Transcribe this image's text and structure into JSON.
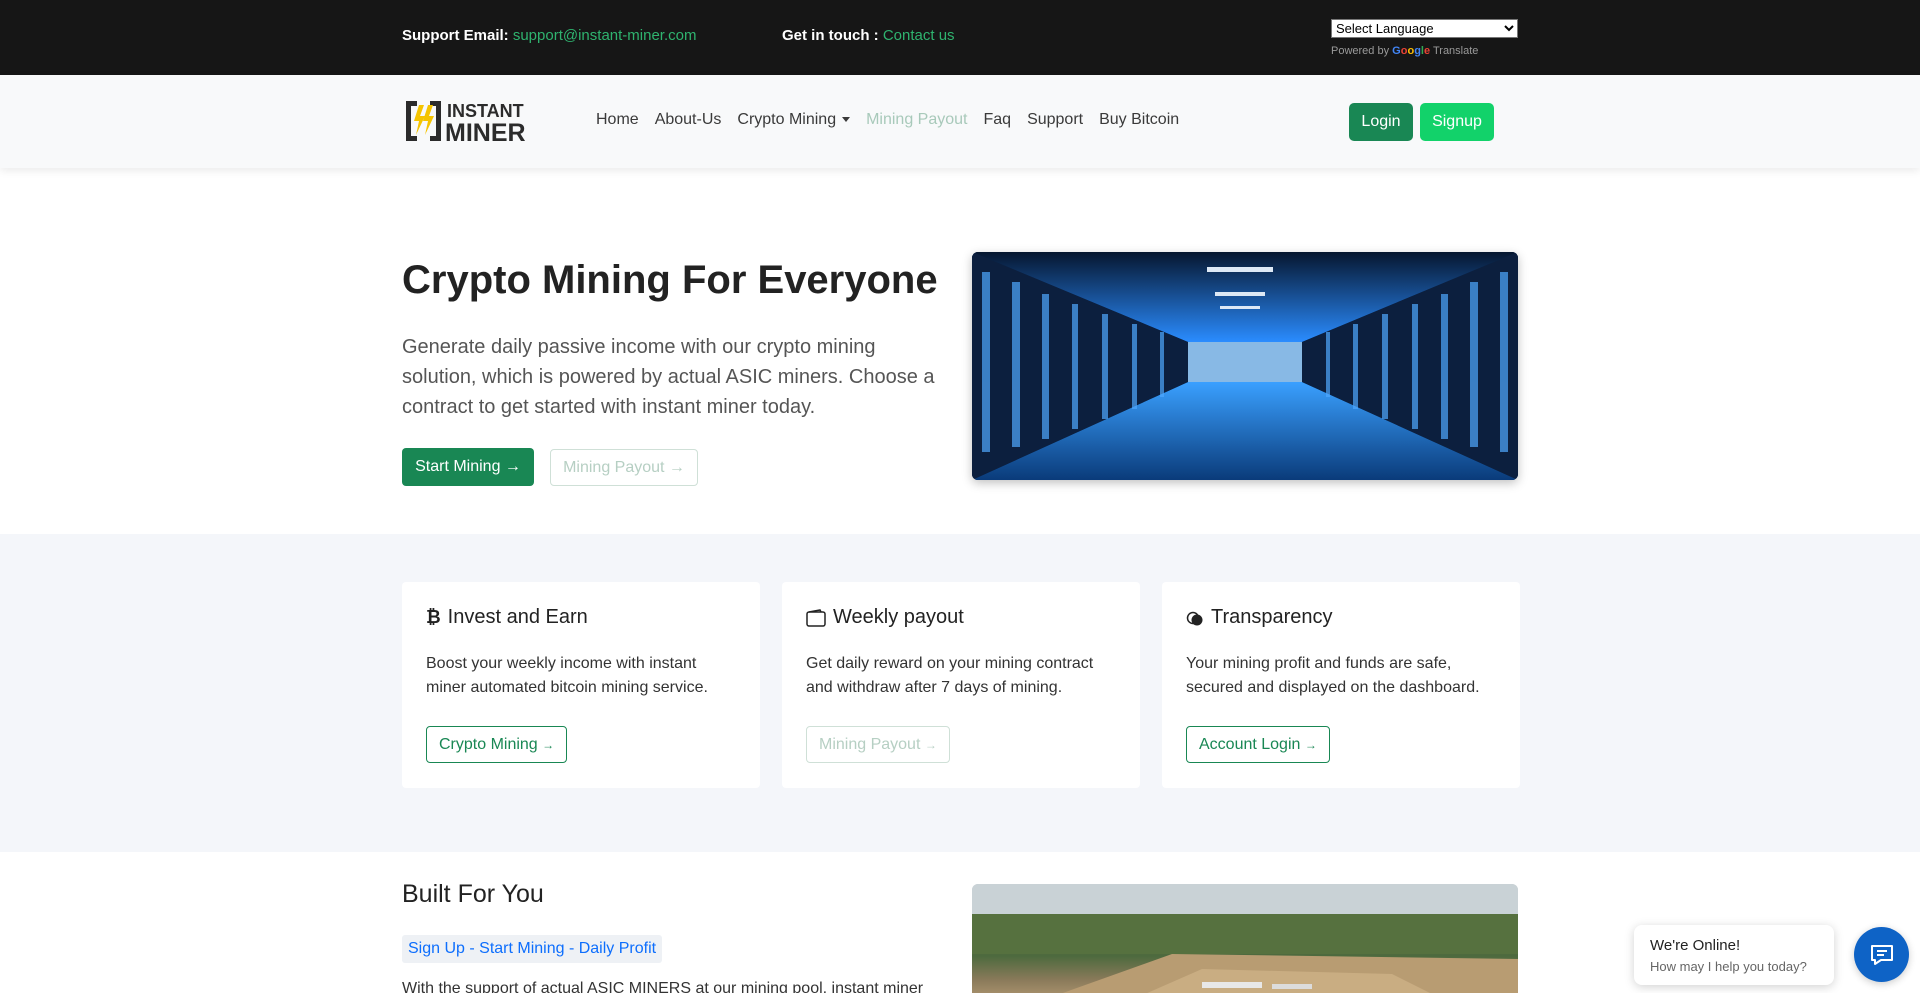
{
  "topbar": {
    "support_label": "Support Email:",
    "support_email": "support@instant-miner.com",
    "touch_label": "Get in touch :",
    "contact_link": "Contact us",
    "language_select": "Select Language",
    "powered_by": "Powered by",
    "google_word": "Google",
    "translate_word": "Translate"
  },
  "brand": {
    "line1": "INSTANT",
    "line2": "MINER",
    "accent": "#f5c400"
  },
  "nav": {
    "items": [
      {
        "label": "Home"
      },
      {
        "label": "About-Us"
      },
      {
        "label": "Crypto Mining"
      },
      {
        "label": "Mining Payout"
      },
      {
        "label": "Faq"
      },
      {
        "label": "Support"
      },
      {
        "label": "Buy Bitcoin"
      }
    ],
    "login": "Login",
    "signup": "Signup"
  },
  "hero": {
    "title": "Crypto Mining For Everyone",
    "text": "Generate daily passive income with our crypto mining solution, which is powered by actual ASIC miners. Choose a contract to get started with instant miner today.",
    "start_button": "Start Mining →",
    "payout_button": "Mining Payout →"
  },
  "features": [
    {
      "title": "Invest and Earn",
      "icon": "bitcoin-icon",
      "text": "Boost your weekly income with instant miner automated bitcoin mining service.",
      "button": "Crypto Mining"
    },
    {
      "title": "Weekly payout",
      "icon": "wallet-icon",
      "text": "Get daily reward on your mining contract and withdraw after 7 days of mining.",
      "button": "Mining Payout"
    },
    {
      "title": "Transparency",
      "icon": "coins-icon",
      "text": "Your mining profit and funds are safe, secured and displayed on the dashboard.",
      "button": "Account Login"
    }
  ],
  "built": {
    "title": "Built For You",
    "badge": "Sign Up - Start Mining - Daily Profit",
    "text": "With the support of actual ASIC MINERS at our mining pool, instant miner"
  },
  "chat": {
    "online": "We're Online!",
    "help": "How may I help you today?"
  },
  "colors": {
    "primary_green": "#198754",
    "signup_green": "#12d26a",
    "topbar": "#161616",
    "chat_blue": "#0e63c6"
  }
}
